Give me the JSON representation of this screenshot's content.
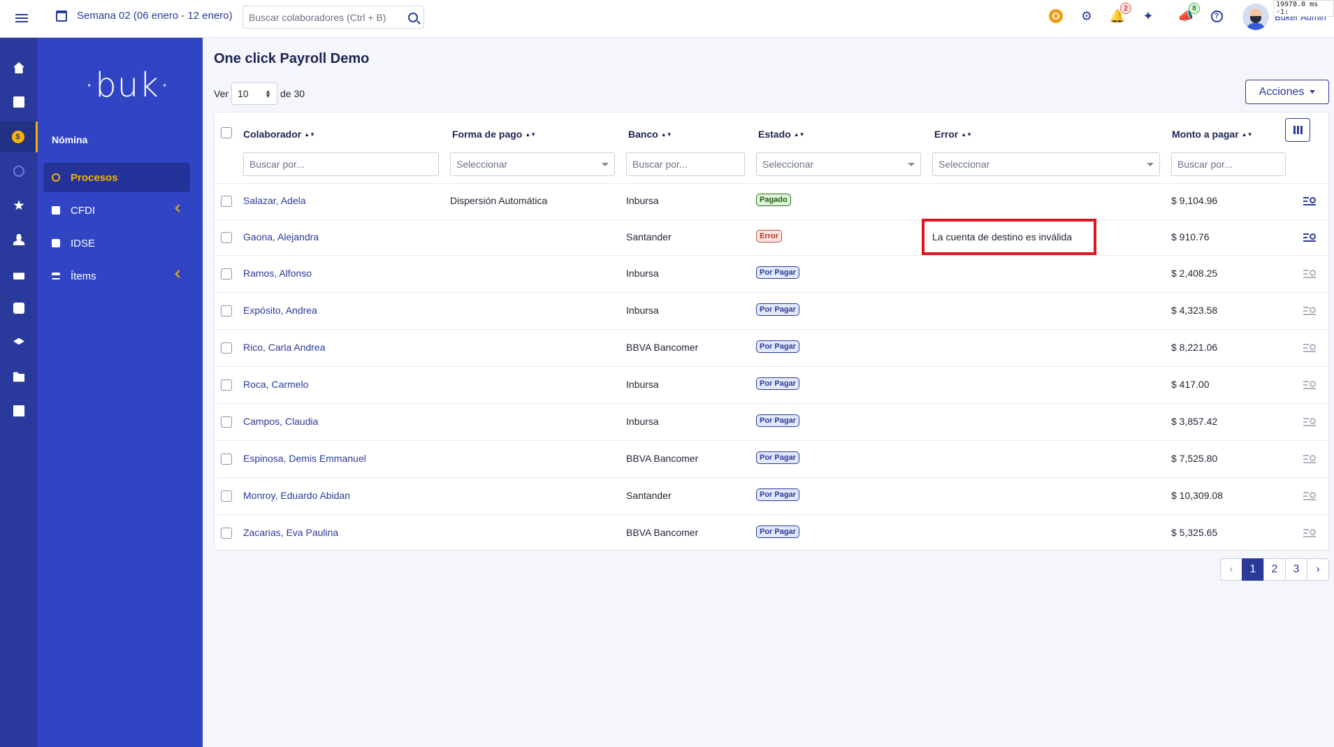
{
  "topbar": {
    "week_label": "Semana 02 (06 enero - 12 enero)",
    "search_placeholder": "Buscar colaboradores (Ctrl + B)",
    "notifications_count": "2",
    "announcements_count": "8",
    "user_name": "Buker Admin",
    "timer": "19978.0 ms ◦1:"
  },
  "sidebar": {
    "logo": "·buk·",
    "section": "Nómina",
    "items": [
      {
        "label": "Procesos",
        "active": true
      },
      {
        "label": "CFDI",
        "has_submenu": true
      },
      {
        "label": "IDSE"
      },
      {
        "label": "Ítems",
        "has_submenu": true
      }
    ],
    "rail_icons": [
      "home-icon",
      "clipboard-icon",
      "payroll-coin-icon",
      "clock-icon",
      "star-icon",
      "user-icon",
      "hand-icon",
      "briefcase-icon",
      "graduation-cap-icon",
      "folder-icon",
      "store-icon"
    ]
  },
  "main": {
    "title": "One click Payroll Demo",
    "ver_label": "Ver",
    "per_page": "10",
    "of_label": "de 30",
    "actions_label": "Acciones"
  },
  "table": {
    "headers": {
      "colaborador": "Colaborador",
      "forma_pago": "Forma de pago",
      "banco": "Banco",
      "estado": "Estado",
      "error": "Error",
      "monto": "Monto a pagar"
    },
    "filters": {
      "colaborador": "Buscar por...",
      "forma_pago": "Seleccionar",
      "banco": "Buscar por...",
      "estado": "Seleccionar",
      "error": "Seleccionar",
      "monto": "Buscar por..."
    },
    "rows": [
      {
        "colaborador": "Salazar, Adela",
        "forma_pago": "Dispersión Automática",
        "banco": "Inbursa",
        "estado": "Pagado",
        "error": "",
        "monto": "$ 9,104.96"
      },
      {
        "colaborador": "Gaona, Alejandra",
        "forma_pago": "",
        "banco": "Santander",
        "estado": "Error",
        "error": "La cuenta de destino es inválida",
        "monto": "$ 910.76"
      },
      {
        "colaborador": "Ramos, Alfonso",
        "forma_pago": "",
        "banco": "Inbursa",
        "estado": "Por Pagar",
        "error": "",
        "monto": "$ 2,408.25"
      },
      {
        "colaborador": "Expósito, Andrea",
        "forma_pago": "",
        "banco": "Inbursa",
        "estado": "Por Pagar",
        "error": "",
        "monto": "$ 4,323.58"
      },
      {
        "colaborador": "Rico, Carla Andrea",
        "forma_pago": "",
        "banco": "BBVA Bancomer",
        "estado": "Por Pagar",
        "error": "",
        "monto": "$ 8,221.06"
      },
      {
        "colaborador": "Roca, Carmelo",
        "forma_pago": "",
        "banco": "Inbursa",
        "estado": "Por Pagar",
        "error": "",
        "monto": "$ 417.00"
      },
      {
        "colaborador": "Campos, Claudia",
        "forma_pago": "",
        "banco": "Inbursa",
        "estado": "Por Pagar",
        "error": "",
        "monto": "$ 3,857.42"
      },
      {
        "colaborador": "Espinosa, Demis Emmanuel",
        "forma_pago": "",
        "banco": "BBVA Bancomer",
        "estado": "Por Pagar",
        "error": "",
        "monto": "$ 7,525.80"
      },
      {
        "colaborador": "Monroy, Eduardo Abidan",
        "forma_pago": "",
        "banco": "Santander",
        "estado": "Por Pagar",
        "error": "",
        "monto": "$ 10,309.08"
      },
      {
        "colaborador": "Zacarias, Eva Paulina",
        "forma_pago": "",
        "banco": "BBVA Bancomer",
        "estado": "Por Pagar",
        "error": "",
        "monto": "$ 5,325.65"
      }
    ]
  },
  "pagination": {
    "prev": "‹",
    "pages": [
      "1",
      "2",
      "3"
    ],
    "current": "1",
    "next": "›"
  },
  "colors": {
    "primary": "#2b3a99",
    "sidebar": "#3145c4",
    "rail": "#2a3a9c",
    "accent": "#f6b400",
    "highlight": "#e0151b"
  }
}
